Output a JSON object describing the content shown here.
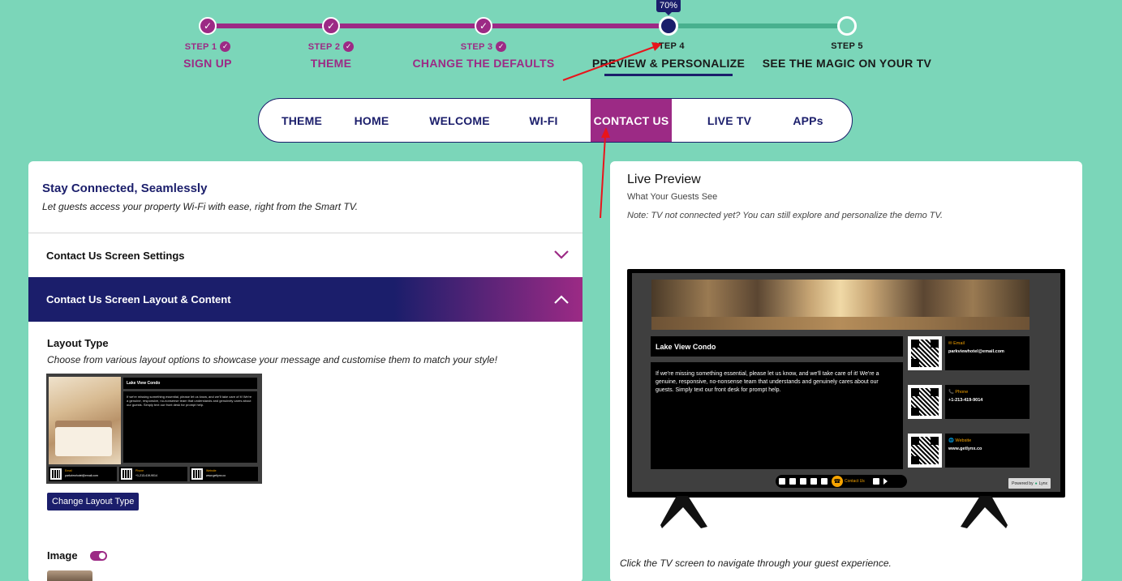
{
  "stepper": {
    "progress_badge": "70%",
    "steps": [
      {
        "number": "STEP 1",
        "name": "SIGN UP",
        "state": "done"
      },
      {
        "number": "STEP 2",
        "name": "THEME",
        "state": "done"
      },
      {
        "number": "STEP 3",
        "name": "CHANGE THE DEFAULTS",
        "state": "done"
      },
      {
        "number": "STEP 4",
        "name": "PREVIEW & PERSONALIZE",
        "state": "current"
      },
      {
        "number": "STEP 5",
        "name": "SEE THE MAGIC ON YOUR TV",
        "state": "todo"
      }
    ],
    "check_glyph": "✓"
  },
  "nav": {
    "tabs": [
      {
        "label": "THEME"
      },
      {
        "label": "HOME"
      },
      {
        "label": "WELCOME"
      },
      {
        "label": "WI-FI"
      },
      {
        "label": "CONTACT US",
        "active": true
      },
      {
        "label": "LIVE TV"
      },
      {
        "label": "APPs"
      }
    ]
  },
  "left": {
    "title": "Stay Connected, Seamlessly",
    "subtitle": "Let guests access your property Wi-Fi with ease, right from the Smart TV.",
    "accordion_settings": "Contact Us Screen Settings",
    "accordion_layout": "Contact Us Screen Layout & Content",
    "layout_type_title": "Layout Type",
    "layout_type_sub": "Choose from various layout options to showcase your message and customise them to match your style!",
    "change_layout_button": "Change Layout Type",
    "image_label": "Image",
    "thumb": {
      "title": "Lake View Condo",
      "body": "If we're missing something essential, please let us know, and we'll take care of it! We're a genuine, responsive, no-nonsense team that understands and genuinely cares about our guests. Simply text our front desk for prompt help.",
      "cards": [
        {
          "label": "Email",
          "value": "parkviewhotel@email.com"
        },
        {
          "label": "Phone",
          "value": "+1-213-419-9014"
        },
        {
          "label": "Website",
          "value": "www.getlynx.co"
        }
      ]
    }
  },
  "right": {
    "title": "Live Preview",
    "subtitle": "What Your Guests See",
    "note": "Note: TV not connected yet? You can still explore and personalize the demo TV.",
    "footer": "Click the TV screen to navigate through your guest experience.",
    "tv": {
      "property_name": "Lake View Condo",
      "message": "If we're missing something essential, please let us know, and we'll take care of it! We're a genuine, responsive, no-nonsense team that understands and genuinely cares about our guests. Simply text our front desk for prompt help.",
      "cards": [
        {
          "label": "✉ Email",
          "value": "parkviewhotel@email.com"
        },
        {
          "label": "📞 Phone",
          "value": "+1-213-419-9014"
        },
        {
          "label": "🌐 Website",
          "value": "www.getlynx.co"
        }
      ],
      "dock_active_label": "Contact Us",
      "powered_by": "Powered by",
      "brand": "Lynx"
    }
  },
  "colors": {
    "background": "#7bd6b9",
    "primary_purple": "#9c2a85",
    "navy": "#1b1e6b",
    "accent_orange": "#f5a300"
  }
}
